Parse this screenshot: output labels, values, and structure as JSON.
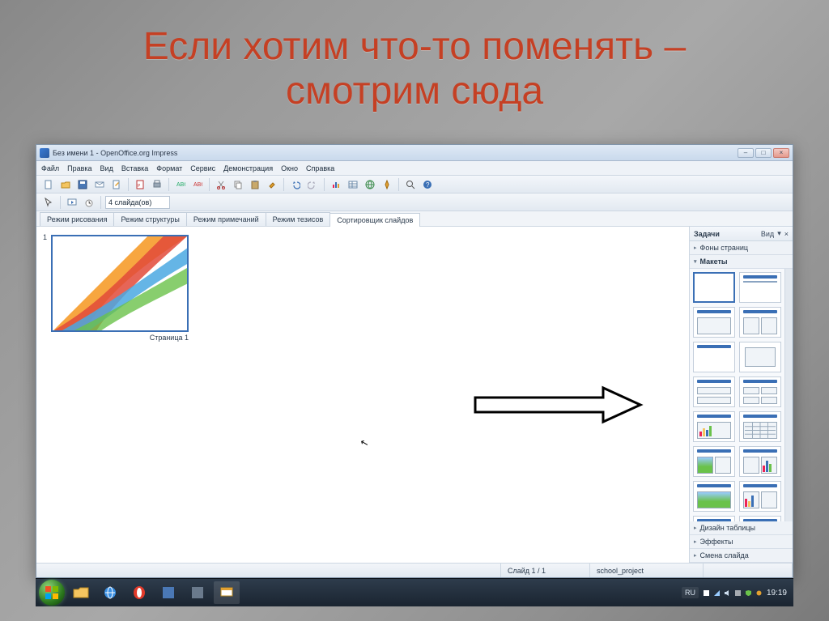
{
  "presentation": {
    "title_line1": "Если хотим что-то поменять –",
    "title_line2": "смотрим сюда"
  },
  "window": {
    "title": "Без имени 1 - OpenOffice.org Impress"
  },
  "menu": {
    "file": "Файл",
    "edit": "Правка",
    "view": "Вид",
    "insert": "Вставка",
    "format": "Формат",
    "tools": "Сервис",
    "slideshow": "Демонстрация",
    "window": "Окно",
    "help": "Справка"
  },
  "toolbar2": {
    "slides_dd": "4 слайда(ов)"
  },
  "tabs": {
    "drawing": "Режим рисования",
    "outline": "Режим структуры",
    "notes": "Режим примечаний",
    "handout": "Режим тезисов",
    "sorter": "Сортировщик слайдов"
  },
  "sorter": {
    "slide1_num": "1",
    "slide1_caption": "Страница 1"
  },
  "taskpane": {
    "header": "Задачи",
    "view_label": "Вид",
    "section_master": "Фоны страниц",
    "section_layouts": "Макеты",
    "section_table": "Дизайн таблицы",
    "section_effects": "Эффекты",
    "section_transition": "Смена слайда"
  },
  "status": {
    "slide": "Слайд 1 / 1",
    "doc": "school_project"
  },
  "tray": {
    "lang": "RU",
    "time": "19:19"
  }
}
